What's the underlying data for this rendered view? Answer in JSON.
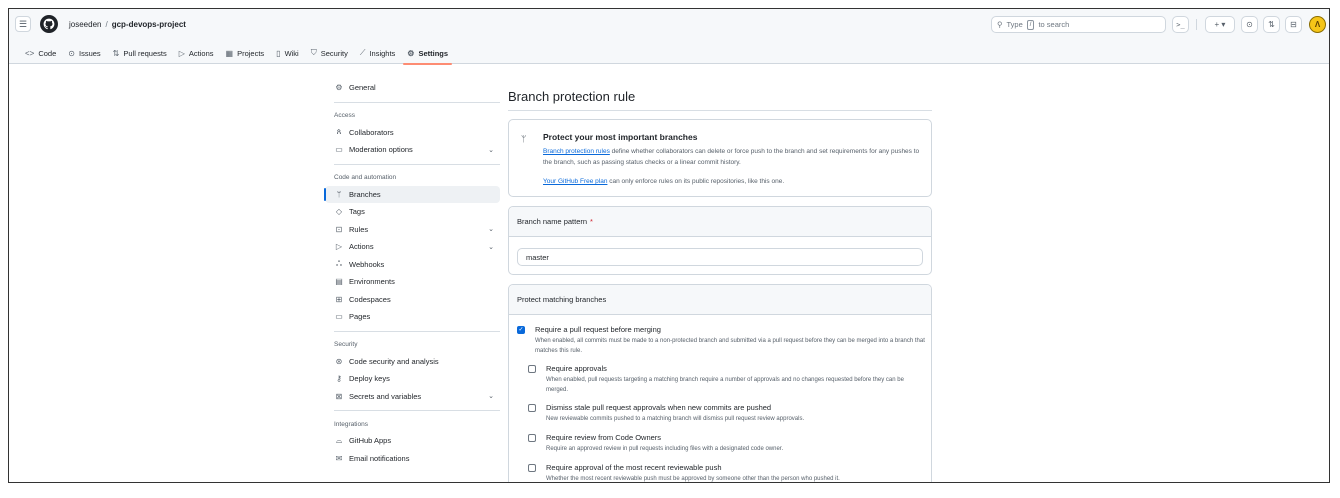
{
  "header": {
    "owner": "joseeden",
    "separator": "/",
    "repo": "gcp-devops-project",
    "search": {
      "prefix": "Type",
      "key": "/",
      "suffix": "to search"
    },
    "command_glyph": ">_",
    "plus_label": "+ ▾",
    "avatar_initial": "Λ"
  },
  "tabs": [
    {
      "icon": "<>",
      "label": "Code"
    },
    {
      "icon": "⊙",
      "label": "Issues"
    },
    {
      "icon": "⇅",
      "label": "Pull requests"
    },
    {
      "icon": "▷",
      "label": "Actions"
    },
    {
      "icon": "▦",
      "label": "Projects"
    },
    {
      "icon": "▯",
      "label": "Wiki"
    },
    {
      "icon": "⛉",
      "label": "Security"
    },
    {
      "icon": "⟋",
      "label": "Insights"
    },
    {
      "icon": "⚙",
      "label": "Settings"
    }
  ],
  "sidebar": {
    "general": "General",
    "access_heading": "Access",
    "collaborators": "Collaborators",
    "moderation": "Moderation options",
    "code_heading": "Code and automation",
    "branches": "Branches",
    "tags": "Tags",
    "rules": "Rules",
    "actions": "Actions",
    "webhooks": "Webhooks",
    "environments": "Environments",
    "codespaces": "Codespaces",
    "pages": "Pages",
    "security_heading": "Security",
    "code_security": "Code security and analysis",
    "deploy_keys": "Deploy keys",
    "secrets": "Secrets and variables",
    "integrations_heading": "Integrations",
    "github_apps": "GitHub Apps",
    "email_notifications": "Email notifications"
  },
  "main": {
    "title": "Branch protection rule",
    "info": {
      "title": "Protect your most important branches",
      "link": "Branch protection rules",
      "text": "define whether collaborators can delete or force push to the branch and set requirements for any pushes to the branch, such as passing status checks or a linear commit history.",
      "plan_link": "Your GitHub Free plan",
      "plan_text": "can only enforce rules on its public repositories, like this one."
    },
    "pattern": {
      "label": "Branch name pattern",
      "required_mark": "*",
      "value": "master"
    },
    "protect": {
      "heading": "Protect matching branches",
      "rules": [
        {
          "title": "Require a pull request before merging",
          "desc": "When enabled, all commits must be made to a non-protected branch and submitted via a pull request before they can be merged into a branch that matches this rule.",
          "checked": true
        },
        {
          "title": "Require approvals",
          "desc": "When enabled, pull requests targeting a matching branch require a number of approvals and no changes requested before they can be merged.",
          "checked": false
        },
        {
          "title": "Dismiss stale pull request approvals when new commits are pushed",
          "desc": "New reviewable commits pushed to a matching branch will dismiss pull request review approvals.",
          "checked": false
        },
        {
          "title": "Require review from Code Owners",
          "desc": "Require an approved review in pull requests including files with a designated code owner.",
          "checked": false
        },
        {
          "title": "Require approval of the most recent reviewable push",
          "desc": "Whether the most recent reviewable push must be approved by someone other than the person who pushed it.",
          "checked": false
        }
      ]
    }
  },
  "colors": {
    "accent": "#0969da",
    "tab_underline": "#fd8c73",
    "avatar": "#f5c518"
  }
}
